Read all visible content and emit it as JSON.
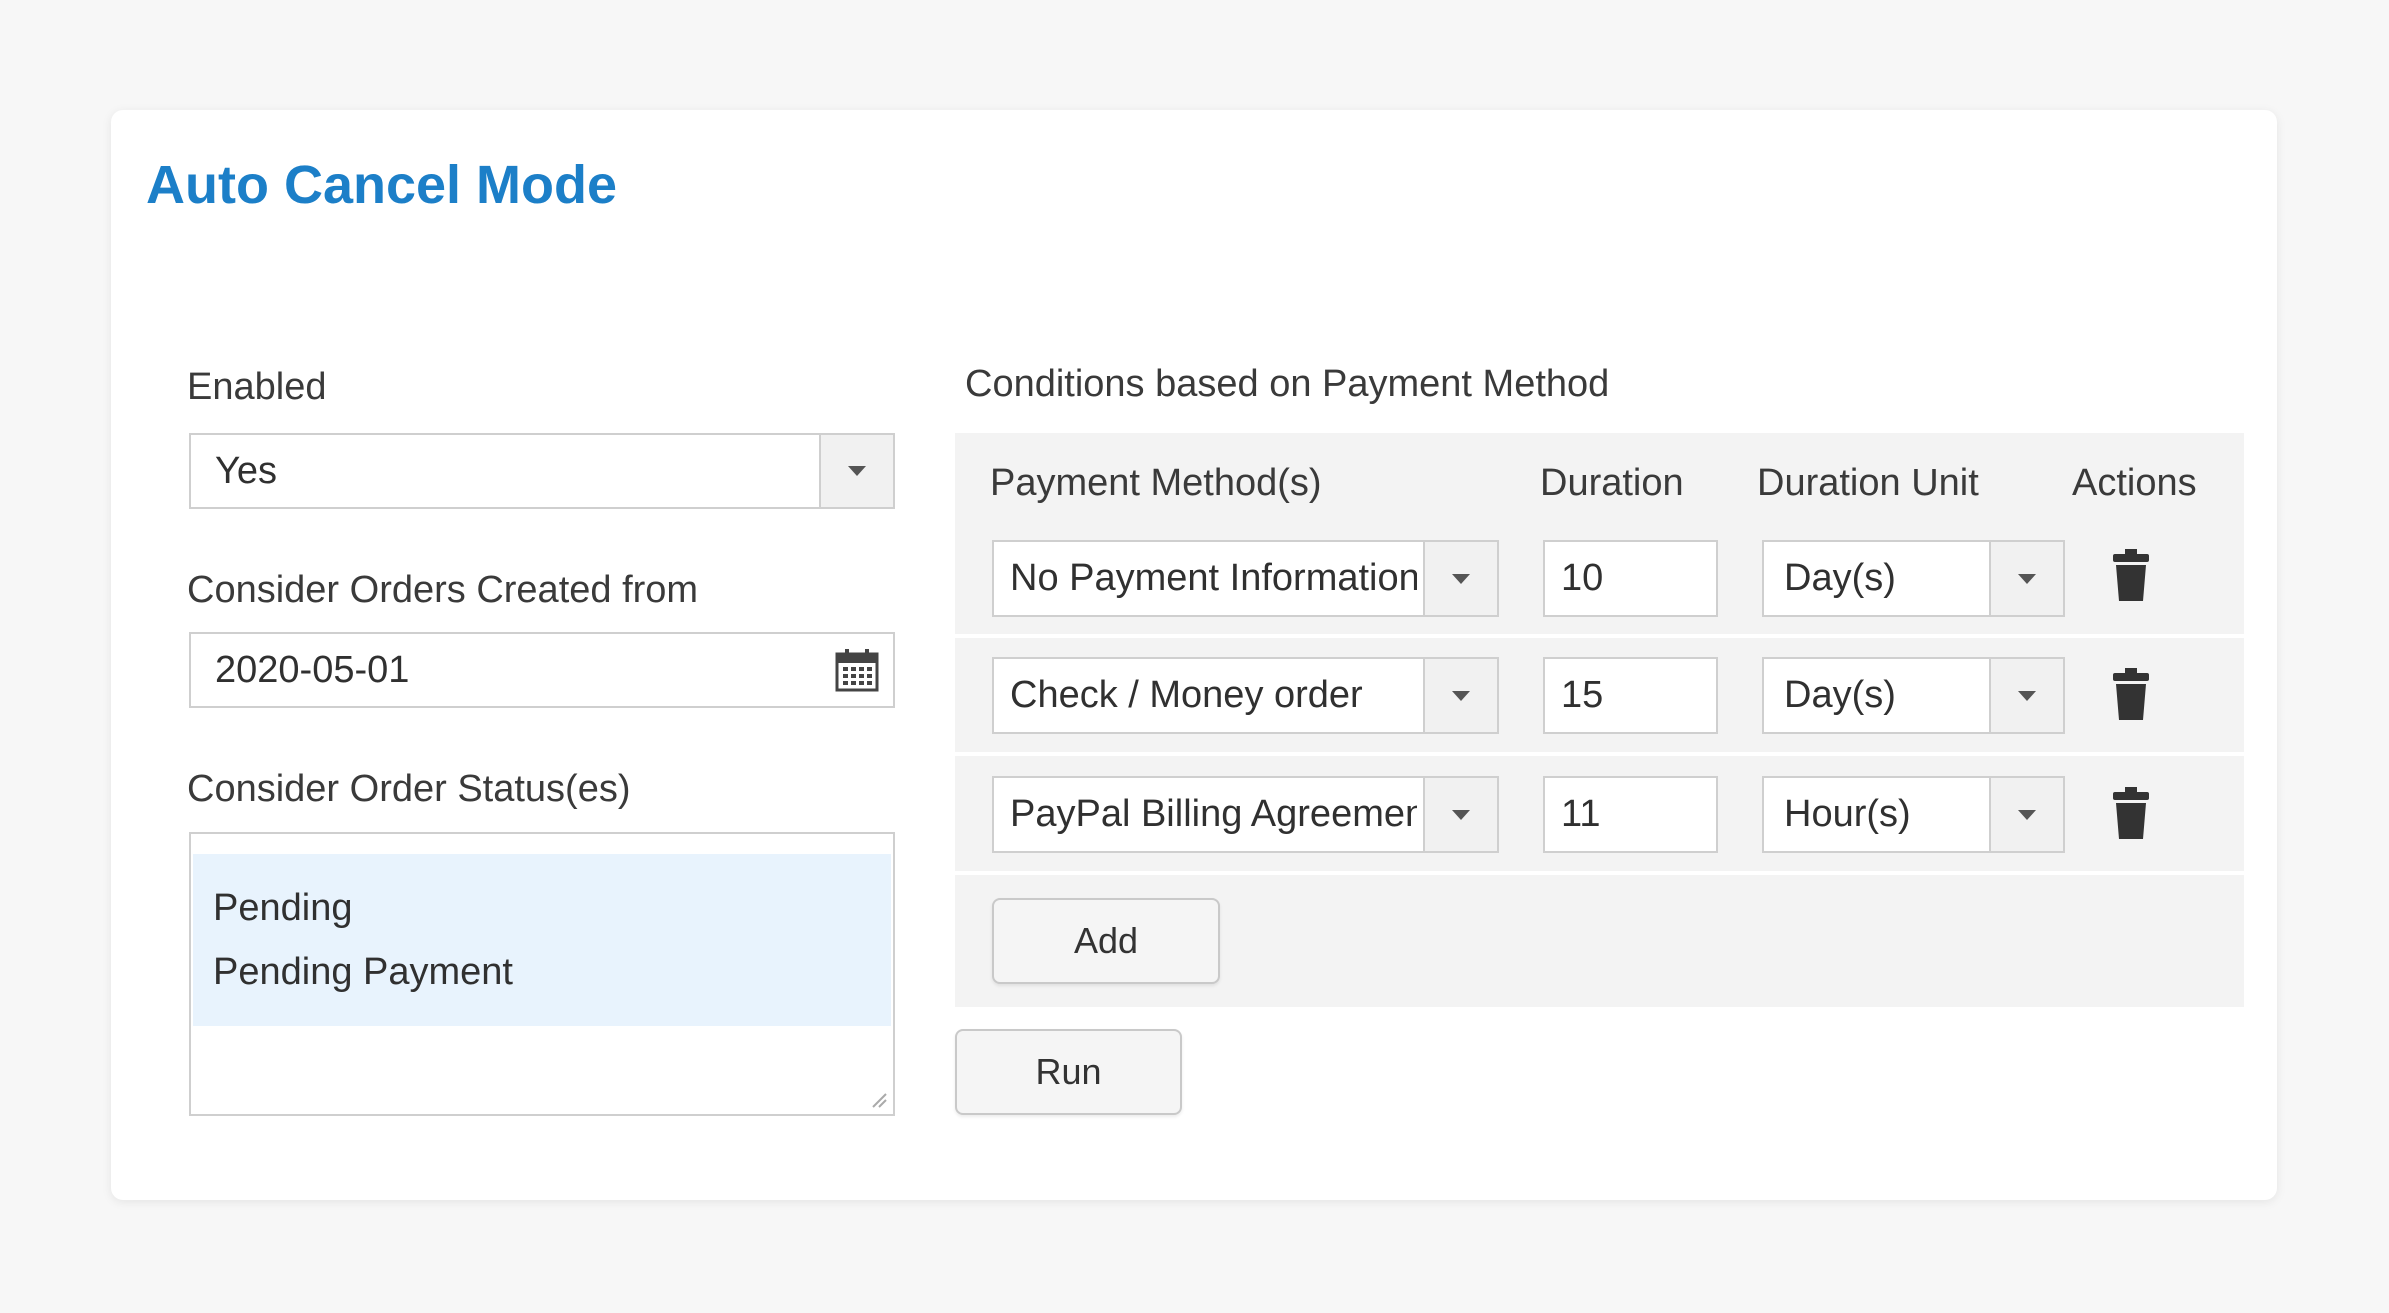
{
  "page_title": "Auto Cancel Mode",
  "left": {
    "enabled_label": "Enabled",
    "enabled_value": "Yes",
    "created_from_label": "Consider Orders Created from",
    "created_from_value": "2020-05-01",
    "statuses_label": "Consider Order Status(es)",
    "statuses": [
      "Pending",
      "Pending Payment"
    ]
  },
  "conditions": {
    "section_label": "Conditions based on Payment Method",
    "columns": {
      "payment_methods": "Payment Method(s)",
      "duration": "Duration",
      "duration_unit": "Duration Unit",
      "actions": "Actions"
    },
    "rows": [
      {
        "payment_method": "No Payment Information",
        "duration": "10",
        "unit": "Day(s)"
      },
      {
        "payment_method": "Check / Money order",
        "duration": "15",
        "unit": "Day(s)"
      },
      {
        "payment_method": "PayPal Billing Agreement",
        "duration": "11",
        "unit": "Hour(s)"
      }
    ],
    "add_label": "Add"
  },
  "run_label": "Run",
  "colors": {
    "title": "#1c7fc8",
    "selected_bg": "#e8f3fd",
    "panel_bg": "#f3f3f3"
  },
  "icons": {
    "select_caret": "chevron-down-icon",
    "date_picker": "calendar-icon",
    "delete": "trash-icon"
  }
}
